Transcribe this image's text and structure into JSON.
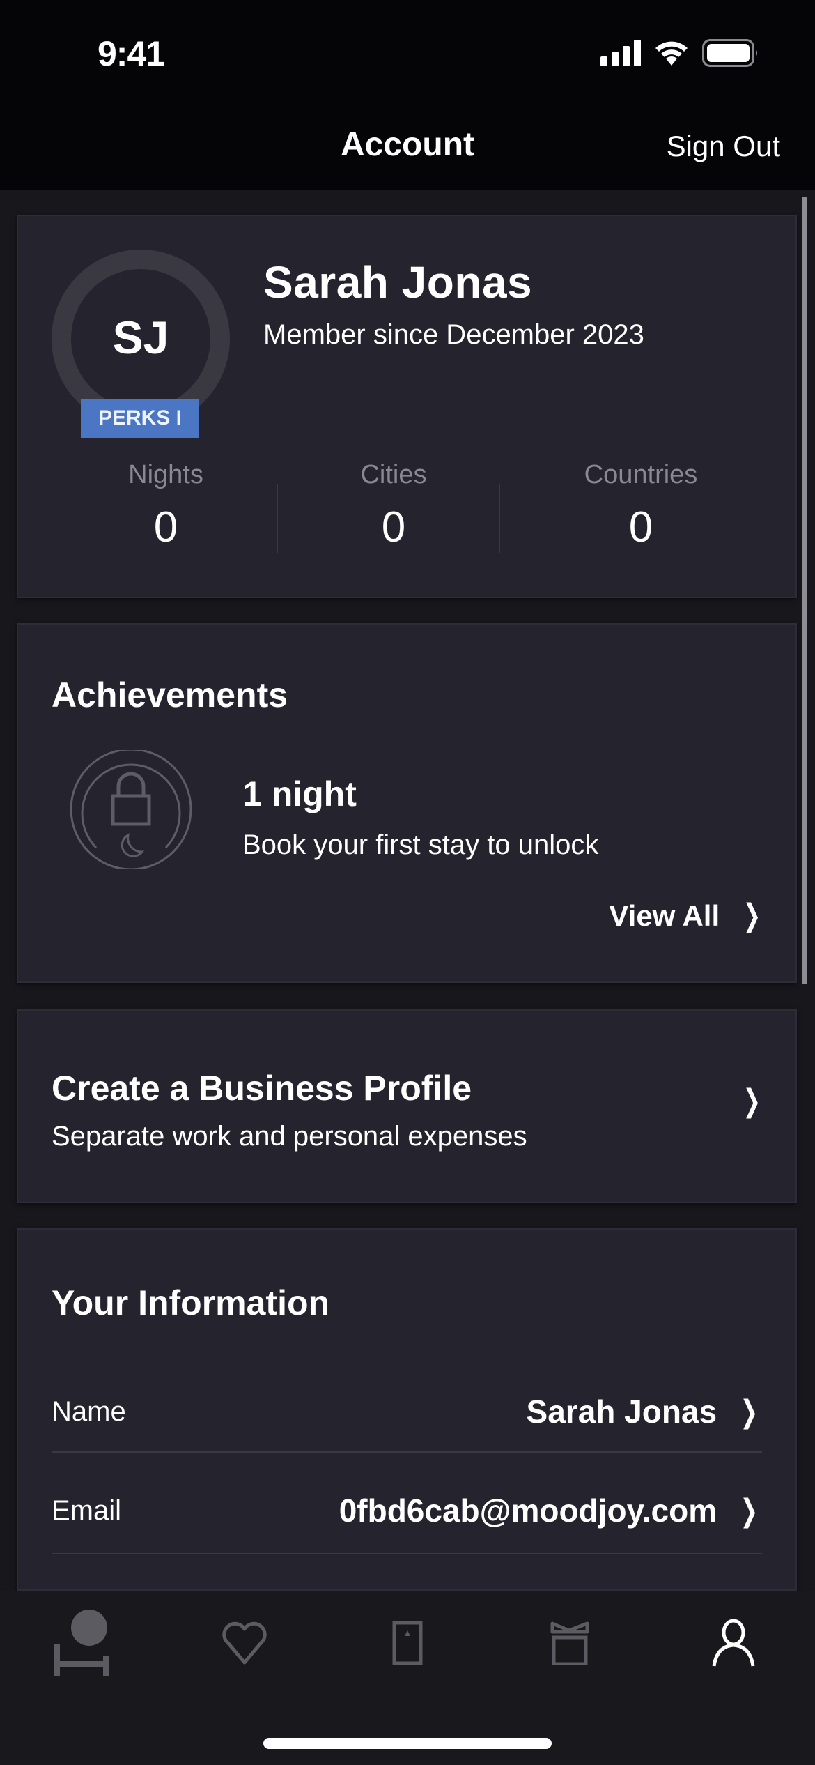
{
  "status_bar": {
    "time": "9:41",
    "icons": [
      "cellular-signal-icon",
      "wifi-icon",
      "battery-icon"
    ]
  },
  "nav": {
    "title": "Account",
    "sign_out_label": "Sign Out"
  },
  "profile": {
    "initials": "SJ",
    "tier_badge": "PERKS I",
    "name": "Sarah Jonas",
    "member_since": "Member since December 2023",
    "stats": [
      {
        "label": "Nights",
        "value": "0"
      },
      {
        "label": "Cities",
        "value": "0"
      },
      {
        "label": "Countries",
        "value": "0"
      }
    ]
  },
  "achievements": {
    "heading": "Achievements",
    "item": {
      "icon": "locked-moon-badge-icon",
      "title": "1 night",
      "description": "Book your first stay to unlock"
    },
    "view_all_label": "View All"
  },
  "business_profile": {
    "title": "Create a Business Profile",
    "subtitle": "Separate work and personal expenses"
  },
  "your_information": {
    "heading": "Your Information",
    "rows": [
      {
        "label": "Name",
        "value": "Sarah Jonas"
      },
      {
        "label": "Email",
        "value": "0fbd6cab@moodjoy.com"
      }
    ]
  },
  "tab_bar": {
    "tabs": [
      {
        "icon": "bed-icon",
        "active": false
      },
      {
        "icon": "heart-icon",
        "active": false
      },
      {
        "icon": "door-icon",
        "active": false
      },
      {
        "icon": "gift-icon",
        "active": false
      },
      {
        "icon": "person-icon",
        "active": true
      }
    ]
  },
  "colors": {
    "background": "#18171b",
    "card": "#24232e",
    "accent_badge": "#4a76c4",
    "muted_text": "#8a8991",
    "inactive_icon": "#5c5b61",
    "active_icon": "#ffffff"
  },
  "chevron_glyph": "❯"
}
